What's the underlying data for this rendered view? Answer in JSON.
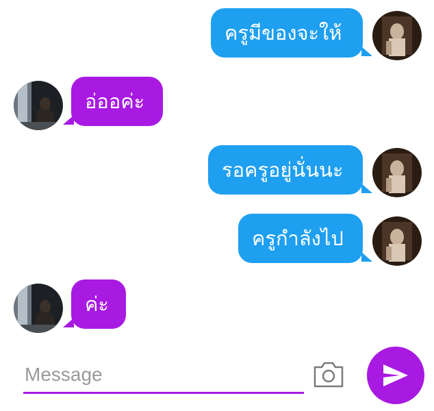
{
  "conversation": {
    "messages": [
      {
        "direction": "outgoing",
        "text": "ครูมีของจะให้"
      },
      {
        "direction": "incoming",
        "text": "อ่ออค่ะ"
      },
      {
        "direction": "outgoing",
        "text": "รอครูอยู่นั่นนะ"
      },
      {
        "direction": "outgoing",
        "text": "ครูกำลังไป"
      },
      {
        "direction": "incoming",
        "text": "ค่ะ"
      }
    ]
  },
  "composer": {
    "placeholder": "Message"
  },
  "colors": {
    "outgoing_bubble": "#1e9ff0",
    "incoming_bubble": "#a81ae2",
    "accent": "#a81ae2",
    "send_button": "#a81ae2"
  },
  "icons": {
    "camera": "camera-icon",
    "send": "send-icon"
  }
}
